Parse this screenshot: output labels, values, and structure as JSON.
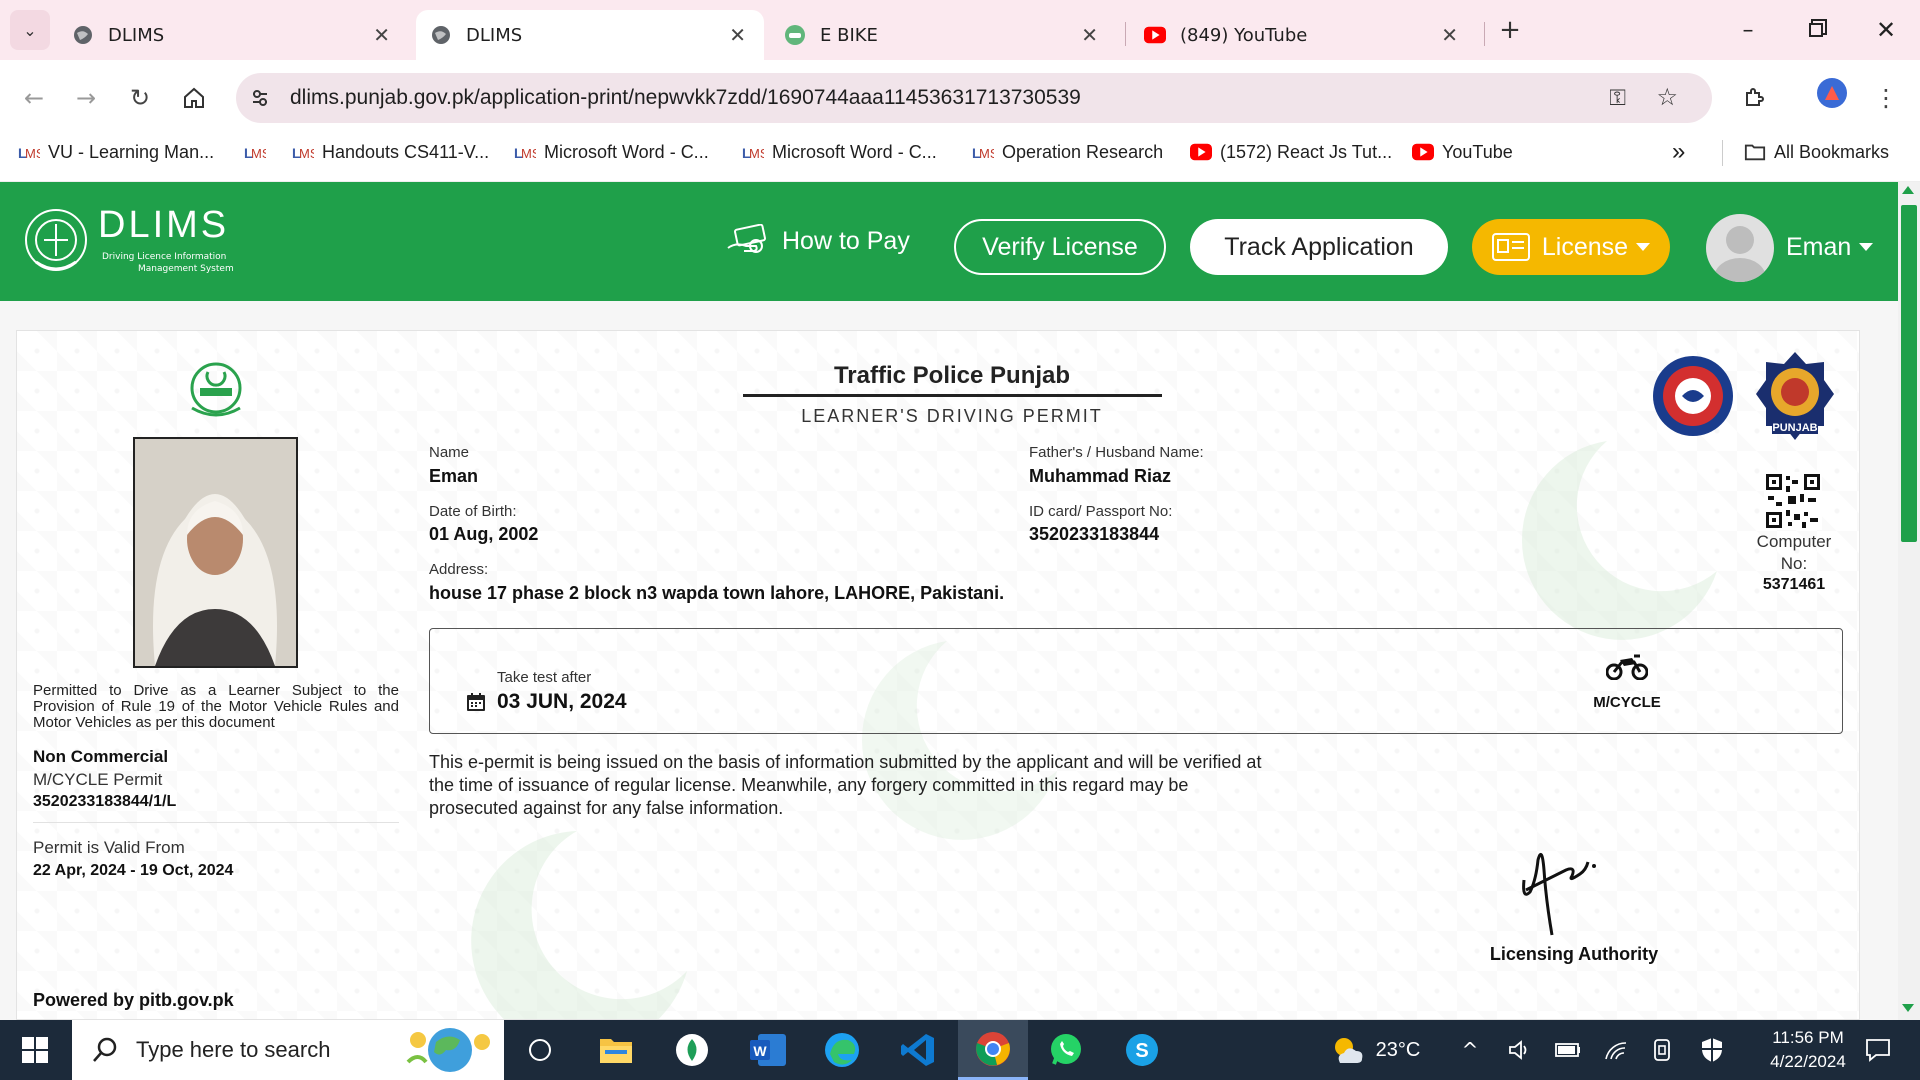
{
  "browser": {
    "tabs": [
      {
        "title": "DLIMS",
        "icon": "globe-icon",
        "active": false
      },
      {
        "title": "DLIMS",
        "icon": "globe-icon",
        "active": true
      },
      {
        "title": "E BIKE",
        "icon": "bike-icon",
        "active": false
      },
      {
        "title": "(849) YouTube",
        "icon": "youtube-icon",
        "active": false
      }
    ],
    "url": "dlims.punjab.gov.pk/application-print/nepwvkk7zdd/1690744aaa11453631713730539",
    "bookmarks": [
      {
        "label": "VU - Learning Man...",
        "icon": "lms-icon"
      },
      {
        "label": "",
        "icon": "lms-icon"
      },
      {
        "label": "Handouts CS411-V...",
        "icon": "lms-icon"
      },
      {
        "label": "Microsoft Word - C...",
        "icon": "lms-icon"
      },
      {
        "label": "Microsoft Word - C...",
        "icon": "lms-icon"
      },
      {
        "label": "Operation Research",
        "icon": "lms-icon"
      },
      {
        "label": "(1572) React Js Tut...",
        "icon": "youtube-icon"
      },
      {
        "label": "YouTube",
        "icon": "youtube-icon"
      }
    ],
    "more_label": "»",
    "all_bookmarks": "All Bookmarks"
  },
  "site": {
    "logo_title": "DLIMS",
    "logo_sub1": "Driving Licence Information",
    "logo_sub2": "Management System",
    "how_to_pay": "How to Pay",
    "verify": "Verify License",
    "track": "Track Application",
    "license": "License",
    "user": "Eman",
    "green": "#1fa04a",
    "yellow": "#f5b800"
  },
  "permit": {
    "org": "Traffic Police Punjab",
    "doc_title": "LEARNER'S DRIVING PERMIT",
    "name_label": "Name",
    "name": "Eman",
    "father_label": "Father's / Husband Name:",
    "father": "Muhammad Riaz",
    "dob_label": "Date of Birth:",
    "dob": "01 Aug, 2002",
    "id_label": "ID card/ Passport No:",
    "id": "3520233183844",
    "address_label": "Address:",
    "address": "house 17 phase 2 block n3 wapda town lahore, LAHORE, Pakistani.",
    "computer_label1": "Computer",
    "computer_label2": "No:",
    "computer_no": "5371461",
    "test_label": "Take test after",
    "test_date": "03 JUN, 2024",
    "vehicle": "M/CYCLE",
    "permit_text": "Permitted to Drive as a Learner Subject to the Provision of Rule 19 of the Motor Vehicle Rules and Motor Vehicles as per this document",
    "category": "Non Commercial",
    "permit_type": "M/CYCLE Permit",
    "permit_no": "3520233183844/1/L",
    "valid_label": "Permit is Valid From",
    "valid_range": "22 Apr, 2024 - 19 Oct, 2024",
    "disclaimer": "This e-permit is being issued on the basis of information submitted by the applicant and will be verified at the time of issuance of regular license. Meanwhile, any forgery committed in this regard may be prosecuted against for any false information.",
    "authority": "Licensing Authority",
    "powered": "Powered by pitb.gov.pk",
    "badge_text": "PUNJAB"
  },
  "taskbar": {
    "search_placeholder": "Type here to search",
    "temperature": "23°C",
    "time": "11:56 PM",
    "date": "4/22/2024"
  }
}
